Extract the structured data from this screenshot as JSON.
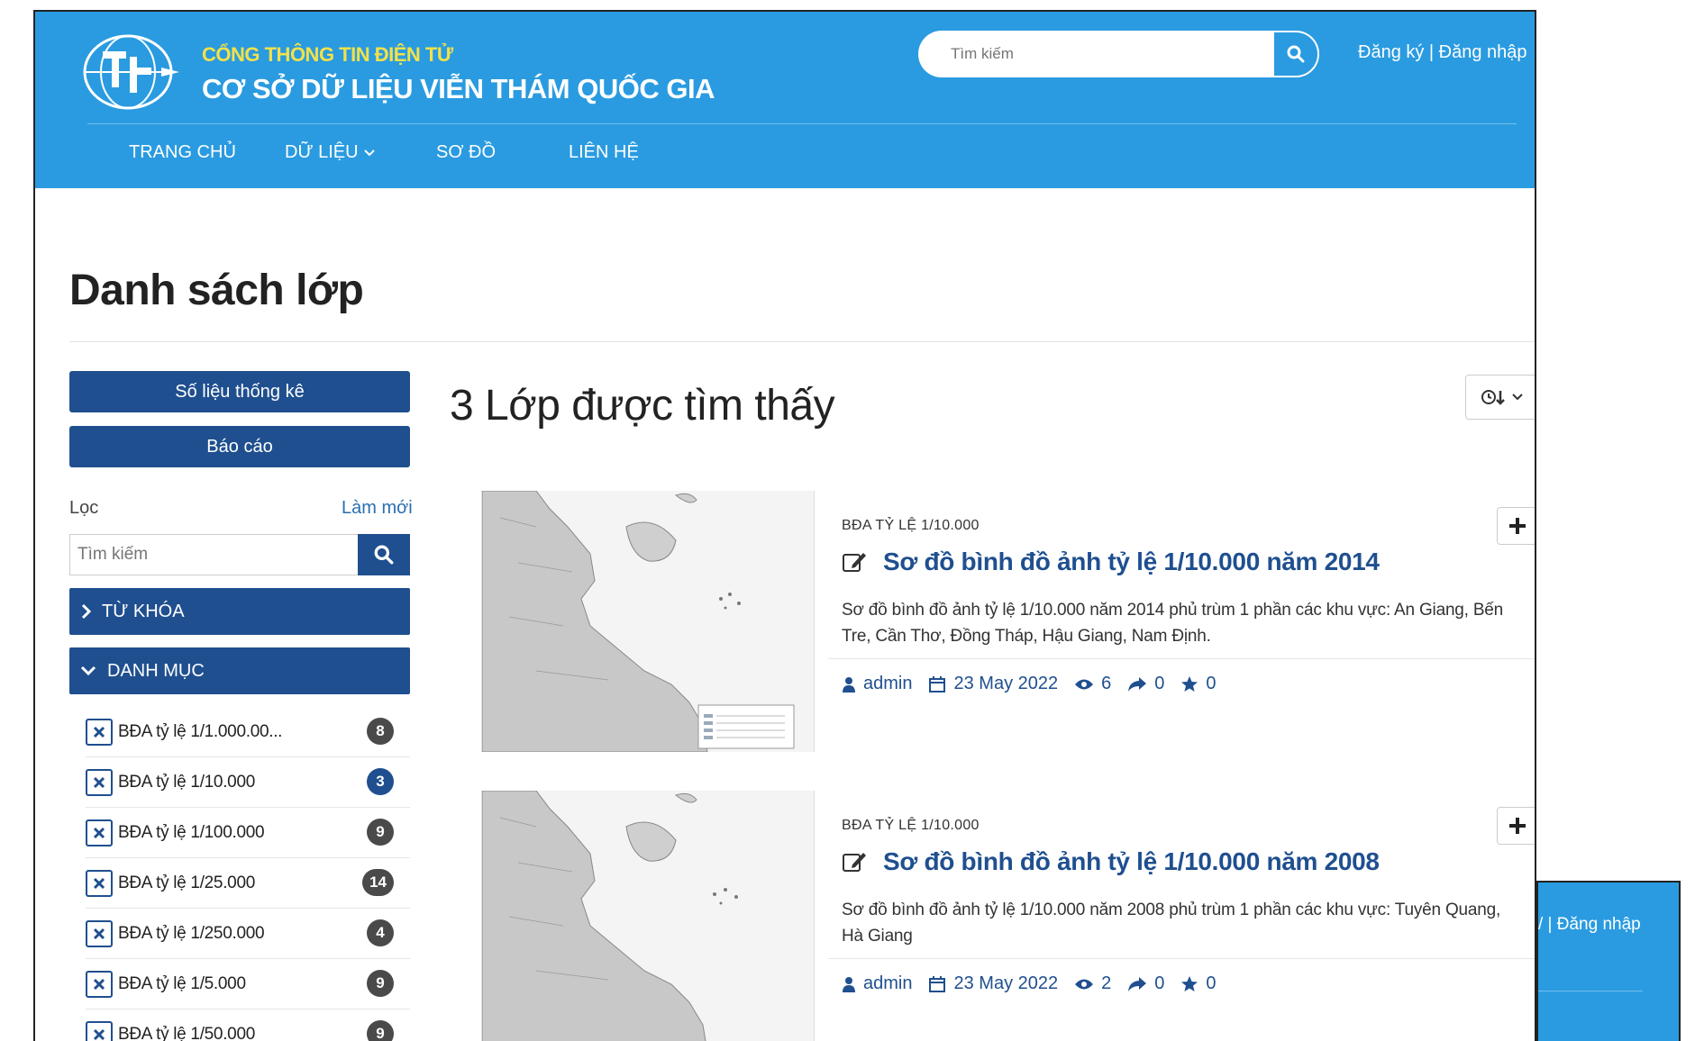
{
  "header": {
    "site_subtitle": "CỔNG THÔNG TIN ĐIỆN TỬ",
    "site_title": "CƠ SỞ DỮ LIỆU VIỄN THÁM QUỐC GIA",
    "search_placeholder": "Tìm kiếm",
    "auth_text": "Đăng ký | Đăng nhập",
    "nav": [
      {
        "label": "TRANG CHỦ"
      },
      {
        "label": "DỮ LIỆU"
      },
      {
        "label": "SƠ ĐỒ"
      },
      {
        "label": "LIÊN HỆ"
      }
    ]
  },
  "page": {
    "title": "Danh sách lớp"
  },
  "sidebar": {
    "stats_button": "Số liệu thống kê",
    "report_button": "Báo cáo",
    "filter_label": "Lọc",
    "reset_label": "Làm mới",
    "search_placeholder": "Tìm kiếm",
    "facet_keywords": "TỪ KHÓA",
    "facet_categories": "DANH MỤC",
    "categories": [
      {
        "label": "BĐA tỷ lệ 1/1.000.00...",
        "count": "8",
        "active": false
      },
      {
        "label": "BĐA tỷ lệ 1/10.000",
        "count": "3",
        "active": true
      },
      {
        "label": "BĐA tỷ lệ 1/100.000",
        "count": "9",
        "active": false
      },
      {
        "label": "BĐA tỷ lệ 1/25.000",
        "count": "14",
        "active": false
      },
      {
        "label": "BĐA tỷ lệ 1/250.000",
        "count": "4",
        "active": false
      },
      {
        "label": "BĐA tỷ lệ 1/5.000",
        "count": "9",
        "active": false
      },
      {
        "label": "BĐA tỷ lệ 1/50.000",
        "count": "9",
        "active": false
      }
    ]
  },
  "results": {
    "count_title": "3 Lớp được tìm thấy",
    "items": [
      {
        "category": "BĐA TỶ LỆ 1/10.000",
        "title": "Sơ đồ bình đồ ảnh tỷ lệ 1/10.000 năm 2014",
        "abstract": "Sơ đồ bình đồ ảnh tỷ lệ 1/10.000 năm 2014 phủ trùm 1 phần các khu vực: An Giang, Bến Tre, Cần Thơ, Đồng Tháp, Hậu Giang, Nam Định.",
        "owner": "admin",
        "date": "23 May 2022",
        "views": "6",
        "shares": "0",
        "rating": "0"
      },
      {
        "category": "BĐA TỶ LỆ 1/10.000",
        "title": "Sơ đồ bình đồ ảnh tỷ lệ 1/10.000 năm 2008",
        "abstract": "Sơ đồ bình đồ ảnh tỷ lệ 1/10.000 năm 2008 phủ trùm 1 phần các khu vực: Tuyên Quang, Hà Giang",
        "owner": "admin",
        "date": "23 May 2022",
        "views": "2",
        "shares": "0",
        "rating": "0"
      }
    ]
  },
  "overlay": {
    "auth_text": "/ | Đăng nhập"
  },
  "colors": {
    "header_blue": "#2a9be0",
    "dark_blue": "#1f4f8f",
    "subtitle_yellow": "#f2e14a"
  }
}
